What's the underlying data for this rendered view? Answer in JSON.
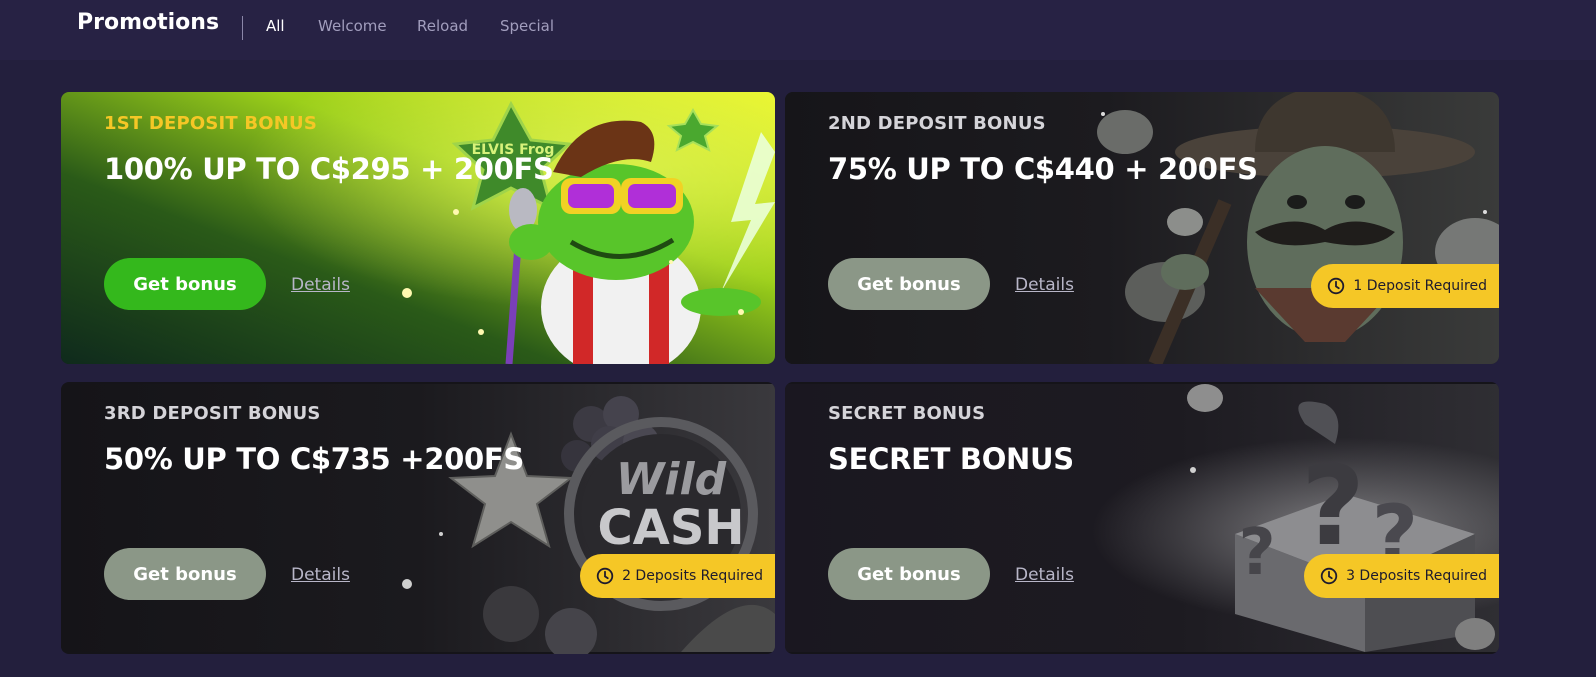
{
  "header": {
    "title": "Promotions",
    "tabs": [
      {
        "label": "All",
        "active": true
      },
      {
        "label": "Welcome",
        "active": false
      },
      {
        "label": "Reload",
        "active": false
      },
      {
        "label": "Special",
        "active": false
      }
    ]
  },
  "colors": {
    "background": "#231f3d",
    "accent_green": "#34b81c",
    "badge_yellow": "#f5c726",
    "label_yellow": "#f5c726"
  },
  "cards": [
    {
      "label": "1ST DEPOSIT BONUS",
      "headline": "100% UP TO C$295 + 200FS",
      "button": "Get bonus",
      "details": "Details",
      "badge": null,
      "art_text": "ELVIS Frog"
    },
    {
      "label": "2ND DEPOSIT BONUS",
      "headline": "75% UP TO C$440 + 200FS",
      "button": "Get bonus",
      "details": "Details",
      "badge": "1 Deposit Required"
    },
    {
      "label": "3RD DEPOSIT BONUS",
      "headline": "50% UP TO C$735 +200FS",
      "button": "Get bonus",
      "details": "Details",
      "badge": "2 Deposits Required",
      "art_text": "Wild CASH"
    },
    {
      "label": "SECRET BONUS",
      "headline": "SECRET BONUS",
      "button": "Get bonus",
      "details": "Details",
      "badge": "3 Deposits Required"
    }
  ]
}
